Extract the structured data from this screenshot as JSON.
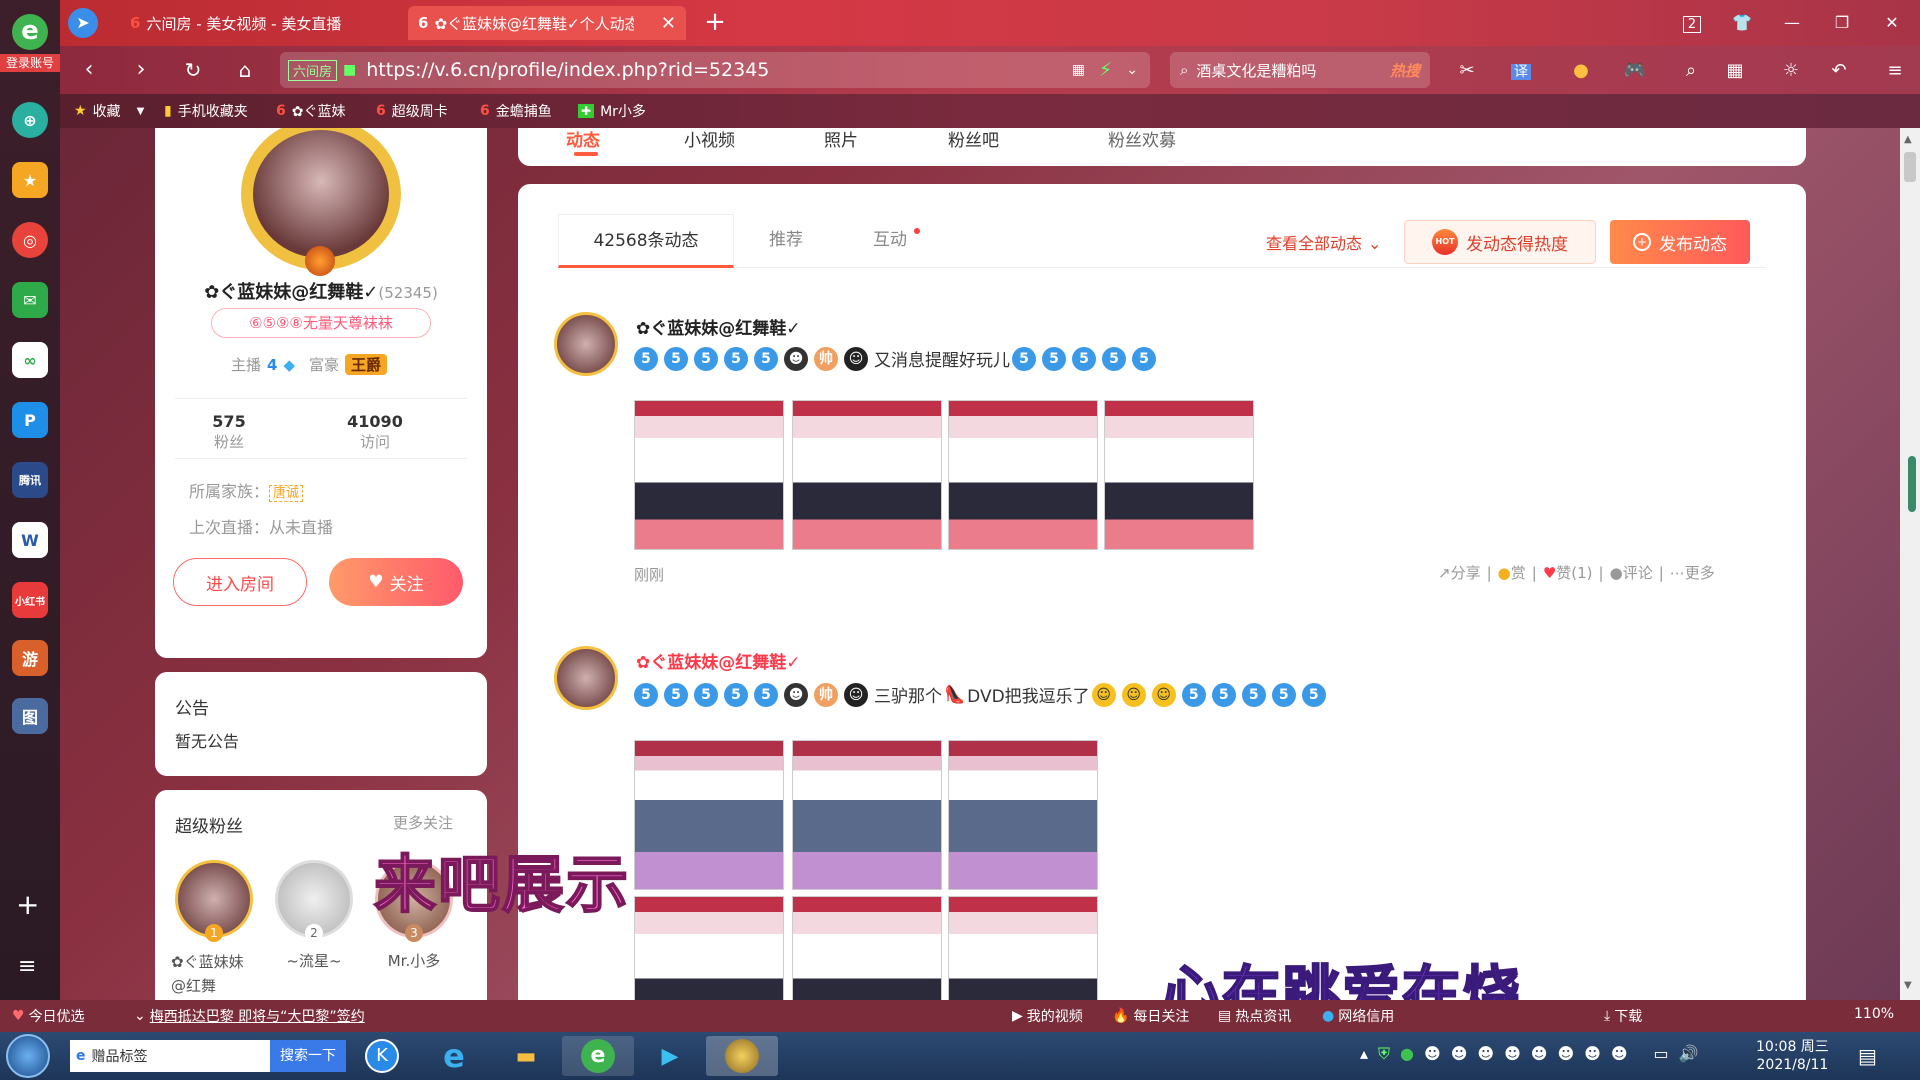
{
  "browser": {
    "logo_text": "e",
    "account": "登录账号",
    "tabs": [
      {
        "label": "六间房 - 美女视频 - 美女直播"
      },
      {
        "label": "✿ぐ蓝妹妹@红舞鞋✓个人动态"
      }
    ],
    "new_tab": "+",
    "window_controls": {
      "counter": "2",
      "min": "—",
      "max": "❐",
      "close": "✕"
    },
    "url_badge": "六间房",
    "url": "https://v.6.cn/profile/index.php?rid=52345",
    "search_text": "酒桌文化是糟粕吗",
    "search_hot": "热搜",
    "translate": "译",
    "bookmarks": [
      {
        "label": "收藏"
      },
      {
        "label": "手机收藏夹"
      },
      {
        "label": "✿ぐ蓝妹"
      },
      {
        "label": "超级周卡"
      },
      {
        "label": "金蟾捕鱼"
      },
      {
        "label": "Mr小多"
      }
    ]
  },
  "sidebar": {
    "items": [
      "⊕",
      "★",
      "◎",
      "✉",
      "∞",
      "P",
      "腾讯",
      "W",
      "小红书",
      "游",
      "图"
    ],
    "plus": "+",
    "menu": "≡"
  },
  "nav": {
    "tabs": [
      "动态",
      "小视频",
      "照片",
      "粉丝吧",
      "粉丝欢募"
    ]
  },
  "profile": {
    "name": "✿ぐ蓝妹妹@红舞鞋✓",
    "rid": "(52345)",
    "badge": "⑥⑤⑨⑧无量天尊袜袜",
    "anchor_label": "主播",
    "anchor_level": "4",
    "rich_label": "富豪",
    "rich_title": "王爵",
    "fans_count": "575",
    "fans_label": "粉丝",
    "visit_count": "41090",
    "visit_label": "访问",
    "family_label": "所属家族：",
    "family_value": "唐诚",
    "last_live": "上次直播：从未直播",
    "enter_room": "进入房间",
    "follow": "关注"
  },
  "notice": {
    "title": "公告",
    "content": "暂无公告"
  },
  "superfans": {
    "title": "超级粉丝",
    "more": "更多关注",
    "fans": [
      {
        "rank": "1",
        "name": "✿ぐ蓝妹妹@红舞"
      },
      {
        "rank": "2",
        "name": "~流星~"
      },
      {
        "rank": "3",
        "name": "Mr.小多"
      }
    ]
  },
  "feed": {
    "tabs": [
      "42568条动态",
      "推荐",
      "互动"
    ],
    "view_all": "查看全部动态",
    "hot_btn": "发动态得热度",
    "hot_badge": "HOT",
    "publish_btn": "发布动态",
    "posts": [
      {
        "author": "✿ぐ蓝妹妹@红舞鞋✓",
        "text": "又消息提醒好玩儿",
        "time": "刚刚",
        "actions": {
          "share": "分享",
          "reward": "赏",
          "like": "赞(1)",
          "comment": "评论",
          "more": "更多"
        }
      },
      {
        "author": "✿ぐ蓝妹妹@红舞鞋✓",
        "text": "三驴那个",
        "text2": "DVD把我逗乐了"
      }
    ]
  },
  "overlays": {
    "text1": "来吧展示",
    "text2": "心在跳爱在烧"
  },
  "statusbar": {
    "left1": "今日优选",
    "headline": "梅西抵达巴黎 即将与“大巴黎”签约",
    "items": [
      "我的视频",
      "每日关注",
      "热点资讯",
      "网络信用",
      "下载"
    ],
    "zoom": "110%"
  },
  "taskbar": {
    "app_label": "赠品标签",
    "search_btn": "搜索一下",
    "time": "10:08 周三",
    "date": "2021/8/11"
  },
  "colors": {
    "accent": "#ff6a3c",
    "pink": "#ff5a6a",
    "link": "#e0402c"
  }
}
